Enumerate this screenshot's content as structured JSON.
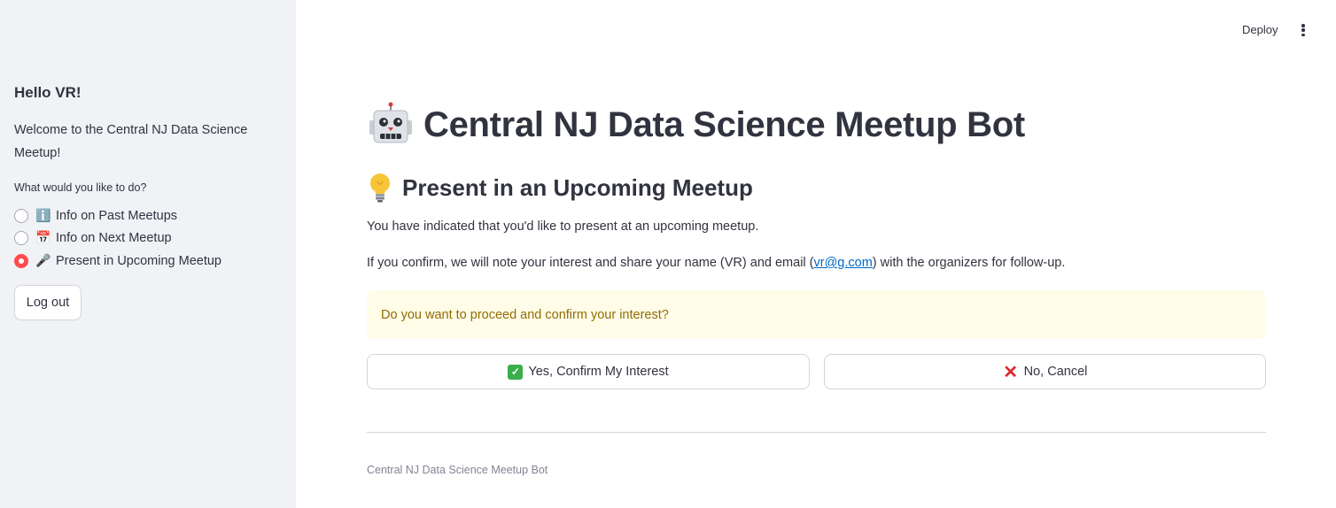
{
  "header": {
    "deploy_label": "Deploy",
    "menu_icon": "kebab-menu-icon"
  },
  "sidebar": {
    "greeting": "Hello VR!",
    "welcome": "Welcome to the Central NJ Data Science Meetup!",
    "question": "What would you like to do?",
    "options": [
      {
        "emoji": "ℹ️",
        "icon": "info-icon",
        "label": "Info on Past Meetups",
        "selected": false
      },
      {
        "emoji": "📅",
        "icon": "calendar-icon",
        "label": "Info on Next Meetup",
        "selected": false
      },
      {
        "emoji": "🎤",
        "icon": "microphone-icon",
        "label": "Present in Upcoming Meetup",
        "selected": true
      }
    ],
    "logout_label": "Log out"
  },
  "main": {
    "title": "Central NJ Data Science Meetup Bot",
    "title_icon": "robot-icon",
    "subtitle": "Present in an Upcoming Meetup",
    "subtitle_icon": "lightbulb-icon",
    "paragraph1": "You have indicated that you'd like to present at an upcoming meetup.",
    "paragraph2_before": "If you confirm, we will note your interest and share your name (VR) and email (",
    "paragraph2_link": "vr@g.com",
    "paragraph2_after": ") with the organizers for follow-up.",
    "warning": "Do you want to proceed and confirm your interest?",
    "confirm_label": "Yes, Confirm My Interest",
    "cancel_label": "No, Cancel",
    "footer": "Central NJ Data Science Meetup Bot"
  },
  "colors": {
    "accent": "#ff4b4b",
    "sidebar_bg": "#f0f2f6",
    "warning_bg": "#fffce7",
    "warning_text": "#926c05",
    "link": "#0068c9"
  }
}
